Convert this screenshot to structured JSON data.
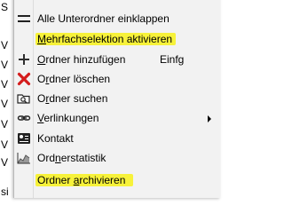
{
  "background_fragments": {
    "top": "S",
    "rows": [
      "V",
      "V",
      "V",
      "V",
      "V",
      "V",
      "V"
    ],
    "bottom": "si"
  },
  "menu": {
    "items": [
      {
        "pre": "Alle Unterordner einklappen",
        "icon": "collapse-icon"
      },
      {
        "pre": "",
        "u": "M",
        "post": "ehrfachselektion aktivieren",
        "icon": "none",
        "highlight": true
      },
      {
        "pre": "",
        "u": "O",
        "post": "rdner hinzufügen",
        "shortcut": "Einfg",
        "icon": "plus-icon"
      },
      {
        "pre": "O",
        "u": "r",
        "post": "dner löschen",
        "icon": "delete-x-icon"
      },
      {
        "pre": "O",
        "u": "r",
        "post": "dner suchen",
        "icon": "search-folder-icon"
      },
      {
        "pre": "",
        "u": "V",
        "post": "erlinkungen",
        "icon": "link-icon",
        "submenu": true
      },
      {
        "pre": "Kontakt",
        "icon": "contact-icon"
      },
      {
        "pre": "Ord",
        "u": "n",
        "post": "erstatistik",
        "icon": "statistics-icon"
      },
      {
        "pre": "Ordner ",
        "u": "a",
        "post": "rchivieren",
        "icon": "none",
        "highlight": true
      }
    ]
  },
  "colors": {
    "menu_bg": "#f2f2f2",
    "highlight": "#f7f23a",
    "delete_red": "#d41c1c"
  }
}
